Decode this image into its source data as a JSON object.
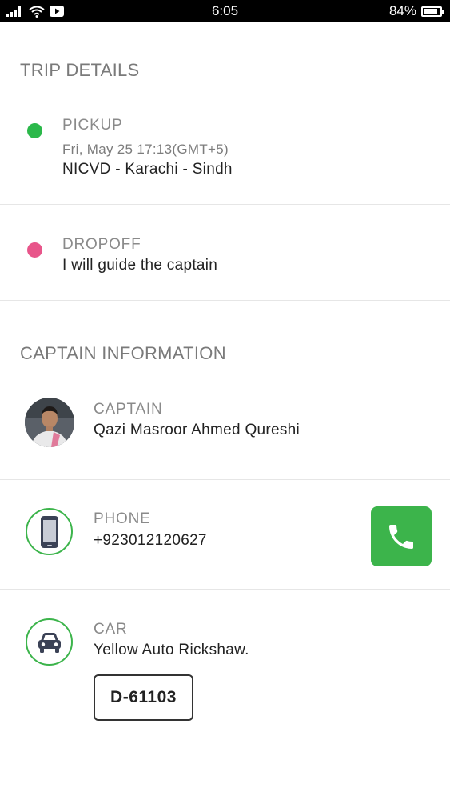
{
  "status_bar": {
    "time": "6:05",
    "battery_percent_label": "84%",
    "battery_level": 0.84
  },
  "trip_details": {
    "title": "TRIP DETAILS",
    "pickup": {
      "label": "PICKUP",
      "datetime": "Fri, May 25 17:13(GMT+5)",
      "location": "NICVD - Karachi - Sindh",
      "dot_color": "#2bb84a"
    },
    "dropoff": {
      "label": "DROPOFF",
      "location": "I will guide the captain",
      "dot_color": "#e8558a"
    }
  },
  "captain_information": {
    "title": "CAPTAIN INFORMATION",
    "captain": {
      "label": "CAPTAIN",
      "name": "Qazi Masroor Ahmed Qureshi"
    },
    "phone": {
      "label": "PHONE",
      "number": "+923012120627",
      "icon": "smartphone-icon",
      "call_icon": "phone-icon"
    },
    "car": {
      "label": "CAR",
      "description": "Yellow Auto Rickshaw.",
      "plate": "D-61103",
      "icon": "car-icon"
    }
  },
  "colors": {
    "accent_green": "#3cb44b",
    "pickup_green": "#2bb84a",
    "dropoff_pink": "#e8558a",
    "icon_navy": "#3b4256"
  }
}
